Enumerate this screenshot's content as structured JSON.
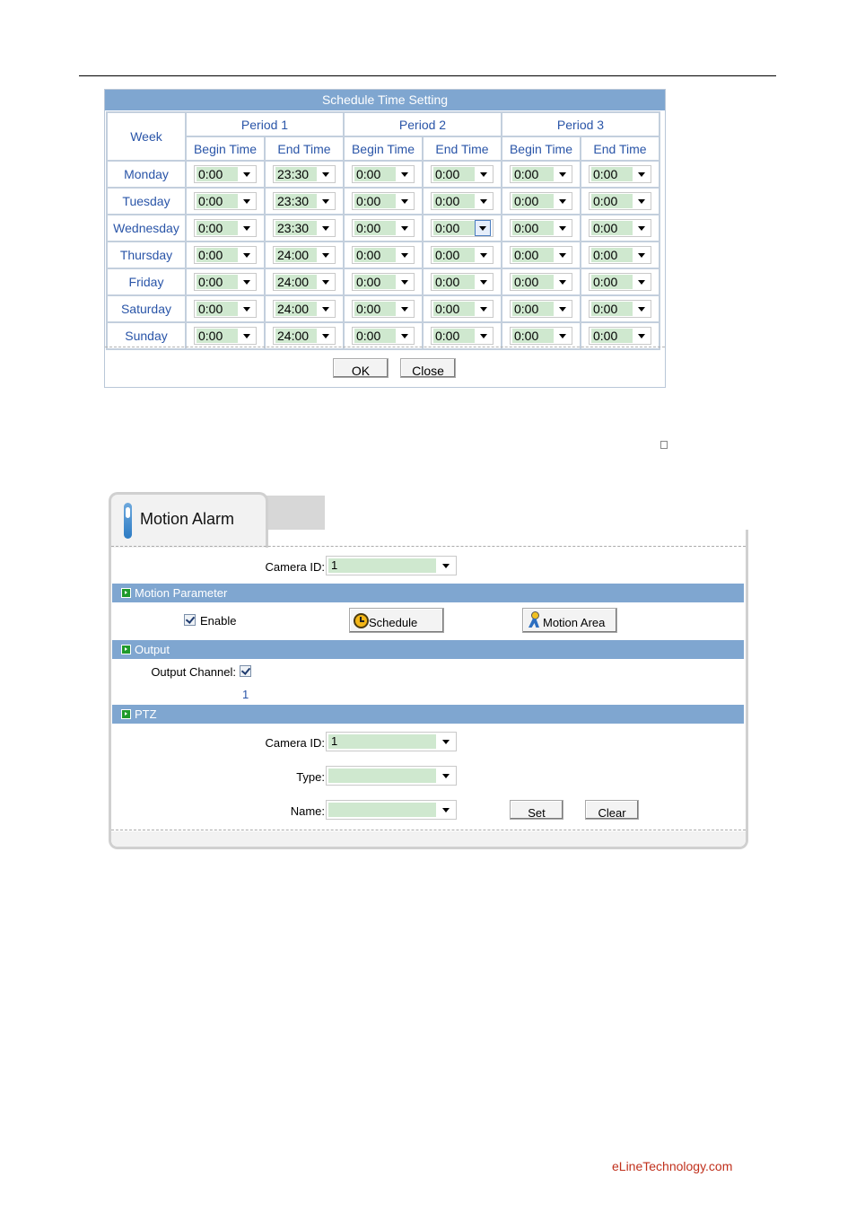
{
  "schedule": {
    "title": "Schedule Time Setting",
    "week_header": "Week",
    "periods": [
      "Period 1",
      "Period 2",
      "Period 3"
    ],
    "begin_label": "Begin Time",
    "end_label": "End Time",
    "days": [
      {
        "name": "Monday",
        "times": [
          "0:00",
          "23:30",
          "0:00",
          "0:00",
          "0:00",
          "0:00"
        ]
      },
      {
        "name": "Tuesday",
        "times": [
          "0:00",
          "23:30",
          "0:00",
          "0:00",
          "0:00",
          "0:00"
        ]
      },
      {
        "name": "Wednesday",
        "times": [
          "0:00",
          "23:30",
          "0:00",
          "0:00",
          "0:00",
          "0:00"
        ]
      },
      {
        "name": "Thursday",
        "times": [
          "0:00",
          "24:00",
          "0:00",
          "0:00",
          "0:00",
          "0:00"
        ]
      },
      {
        "name": "Friday",
        "times": [
          "0:00",
          "24:00",
          "0:00",
          "0:00",
          "0:00",
          "0:00"
        ]
      },
      {
        "name": "Saturday",
        "times": [
          "0:00",
          "24:00",
          "0:00",
          "0:00",
          "0:00",
          "0:00"
        ]
      },
      {
        "name": "Sunday",
        "times": [
          "0:00",
          "24:00",
          "0:00",
          "0:00",
          "0:00",
          "0:00"
        ]
      }
    ],
    "ok_label": "OK",
    "close_label": "Close"
  },
  "motion": {
    "tab_title": "Motion Alarm",
    "camera_id_label": "Camera ID:",
    "camera_id_value": "1",
    "motion_param_title": "Motion Parameter",
    "enable_label": "Enable",
    "schedule_label": "Schedule",
    "motion_area_label": "Motion Area",
    "output_title": "Output",
    "output_channel_label": "Output Channel:",
    "output_channel_number": "1",
    "ptz_title": "PTZ",
    "ptz_camera_id_label": "Camera ID:",
    "ptz_camera_id_value": "1",
    "type_label": "Type:",
    "type_value": "",
    "name_label": "Name:",
    "name_value": "",
    "set_label": "Set",
    "clear_label": "Clear"
  },
  "footer": {
    "site": "eLineTechnology.com"
  }
}
